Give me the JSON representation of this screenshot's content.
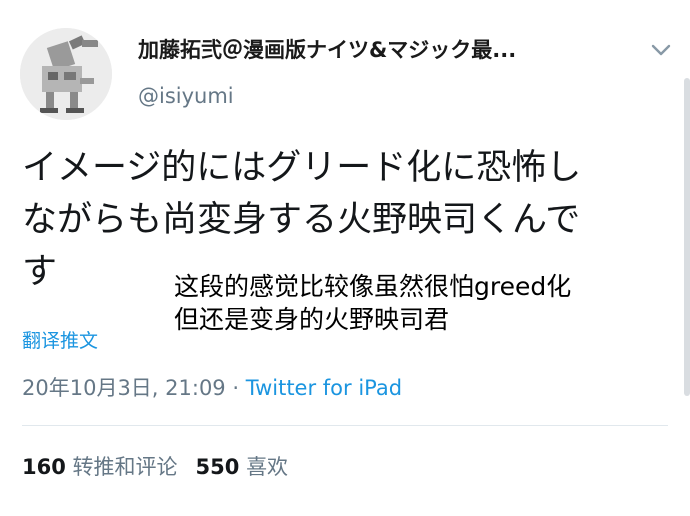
{
  "tweet": {
    "author_name": "加藤拓弐＠漫画版ナイツ&マジック最...",
    "handle": "@isiyumi",
    "text_lines": [
      "イメージ的にはグリード化に恐怖し",
      "ながらも尚変身する火野映司くんで",
      "す"
    ],
    "translate_label": "翻译推文",
    "date": "20年10月3日, 21:09",
    "separator": " · ",
    "source": "Twitter for iPad",
    "stats": {
      "retweets_count": "160",
      "retweets_label": "转推和评论",
      "likes_count": "550",
      "likes_label": "喜欢"
    }
  },
  "overlay_note": {
    "lines": [
      "这段的感觉比较像虽然很怕greed化",
      "但还是变身的火野映司君"
    ]
  },
  "icons": {
    "avatar": "avatar-robot-icon",
    "chevron": "chevron-down-icon"
  },
  "colors": {
    "link_blue": "#1b95e0",
    "secondary_gray": "#657786",
    "divider": "#e1e8ed"
  }
}
